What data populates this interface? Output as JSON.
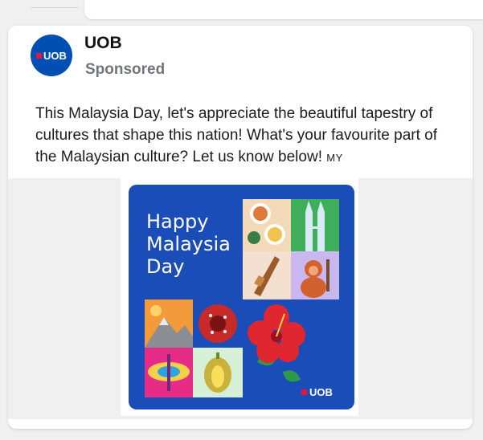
{
  "post": {
    "author": "UOB",
    "avatar_text": "UOB",
    "label": "Sponsored",
    "text": "This Malaysia Day, let's appreciate the beautiful tapestry of cultures that shape this nation! What's your favourite part of the Malaysian culture? Let us know below!",
    "flag_text": "MY"
  },
  "ad_image": {
    "headline_lines": [
      "Happy",
      "Malaysia",
      "Day"
    ],
    "brand_text": "UOB"
  },
  "colors": {
    "brand_blue": "#1a4db8",
    "brand_red": "#e3173e",
    "page_bg": "#f0f0f0"
  },
  "icons": [
    "uob-logo-icon",
    "food-icon",
    "twin-towers-icon",
    "sape-guitar-icon",
    "orangutan-icon",
    "mountain-icon",
    "rafflesia-icon",
    "hibiscus-icon",
    "wau-kite-icon",
    "durian-icon"
  ]
}
